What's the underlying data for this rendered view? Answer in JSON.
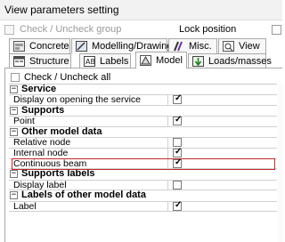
{
  "window": {
    "title": "View parameters setting"
  },
  "top": {
    "check_uncheck_group": "Check / Uncheck group",
    "lock_position": "Lock position"
  },
  "tabs": {
    "row1": [
      {
        "label": "Concrete",
        "icon": "concrete-icon"
      },
      {
        "label": "Modelling/Drawing",
        "icon": "modelling-drawing-icon"
      },
      {
        "label": "Misc.",
        "icon": "misc-icon"
      },
      {
        "label": "View",
        "icon": "view-icon"
      }
    ],
    "row2": [
      {
        "label": "Structure",
        "icon": "structure-icon"
      },
      {
        "label": "Labels",
        "icon": "labels-icon"
      },
      {
        "label": "Model",
        "icon": "model-icon",
        "active": true
      },
      {
        "label": "Loads/masses",
        "icon": "loads-masses-icon"
      }
    ]
  },
  "panel": {
    "check_all": "Check / Uncheck all",
    "groups": [
      {
        "label": "Service",
        "items": [
          {
            "label": "Display on opening the service",
            "checked": true
          }
        ]
      },
      {
        "label": "Supports",
        "items": [
          {
            "label": "Point",
            "checked": true
          }
        ]
      },
      {
        "label": "Other model data",
        "items": [
          {
            "label": "Relative node",
            "checked": false
          },
          {
            "label": "Internal node",
            "checked": true
          },
          {
            "label": "Continuous beam",
            "checked": true,
            "highlighted": true
          }
        ]
      },
      {
        "label": "Supports labels",
        "items": [
          {
            "label": "Display label",
            "checked": false
          }
        ]
      },
      {
        "label": "Labels of other model data",
        "items": [
          {
            "label": "Label",
            "checked": true
          }
        ]
      }
    ]
  },
  "colors": {
    "highlight_border": "#c0282e",
    "grid_line": "#d0d0d0",
    "tab_border": "#a9a9a9"
  }
}
